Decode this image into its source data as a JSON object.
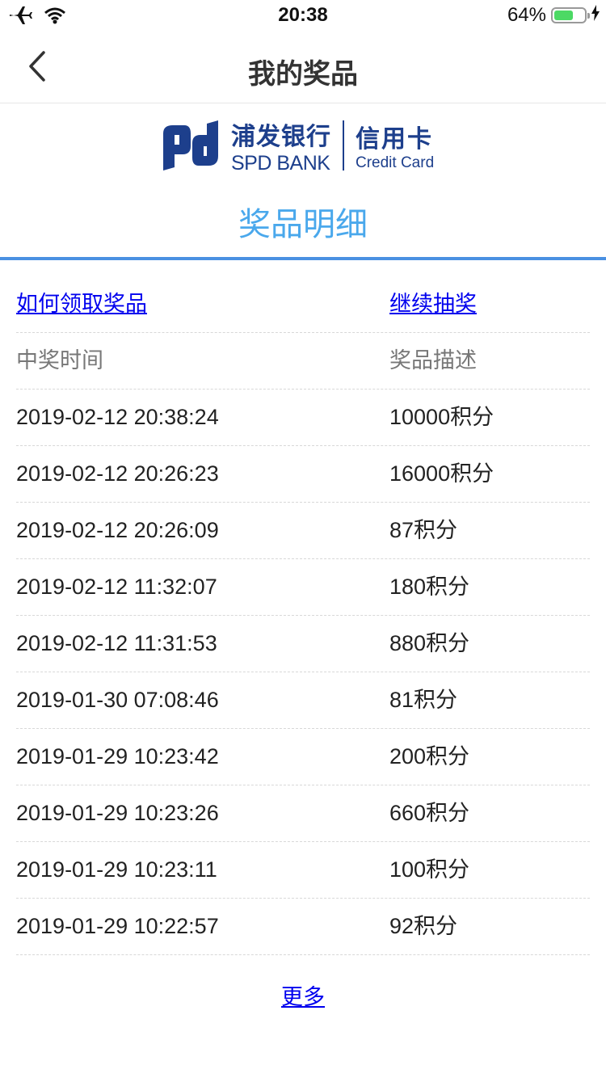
{
  "status_bar": {
    "time": "20:38",
    "battery": "64%",
    "battery_level": 0.64
  },
  "nav": {
    "title": "我的奖品"
  },
  "logo": {
    "cn": "浦发银行",
    "en": "SPD BANK",
    "card_cn": "信用卡",
    "card_en": "Credit Card"
  },
  "section_title": "奖品明细",
  "links": {
    "how_to_claim": "如何领取奖品",
    "continue_draw": "继续抽奖",
    "more": "更多"
  },
  "table": {
    "headers": [
      "中奖时间",
      "奖品描述"
    ],
    "rows": [
      [
        "2019-02-12 20:38:24",
        "10000积分"
      ],
      [
        "2019-02-12 20:26:23",
        "16000积分"
      ],
      [
        "2019-02-12 20:26:09",
        "87积分"
      ],
      [
        "2019-02-12 11:32:07",
        "180积分"
      ],
      [
        "2019-02-12 11:31:53",
        "880积分"
      ],
      [
        "2019-01-30 07:08:46",
        "81积分"
      ],
      [
        "2019-01-29 10:23:42",
        "200积分"
      ],
      [
        "2019-01-29 10:23:26",
        "660积分"
      ],
      [
        "2019-01-29 10:23:11",
        "100积分"
      ],
      [
        "2019-01-29 10:22:57",
        "92积分"
      ]
    ]
  },
  "colors": {
    "accent": "#4a90e2",
    "title_blue": "#4aa8ec",
    "brand": "#1d3f8c",
    "link": "#0000ee"
  }
}
